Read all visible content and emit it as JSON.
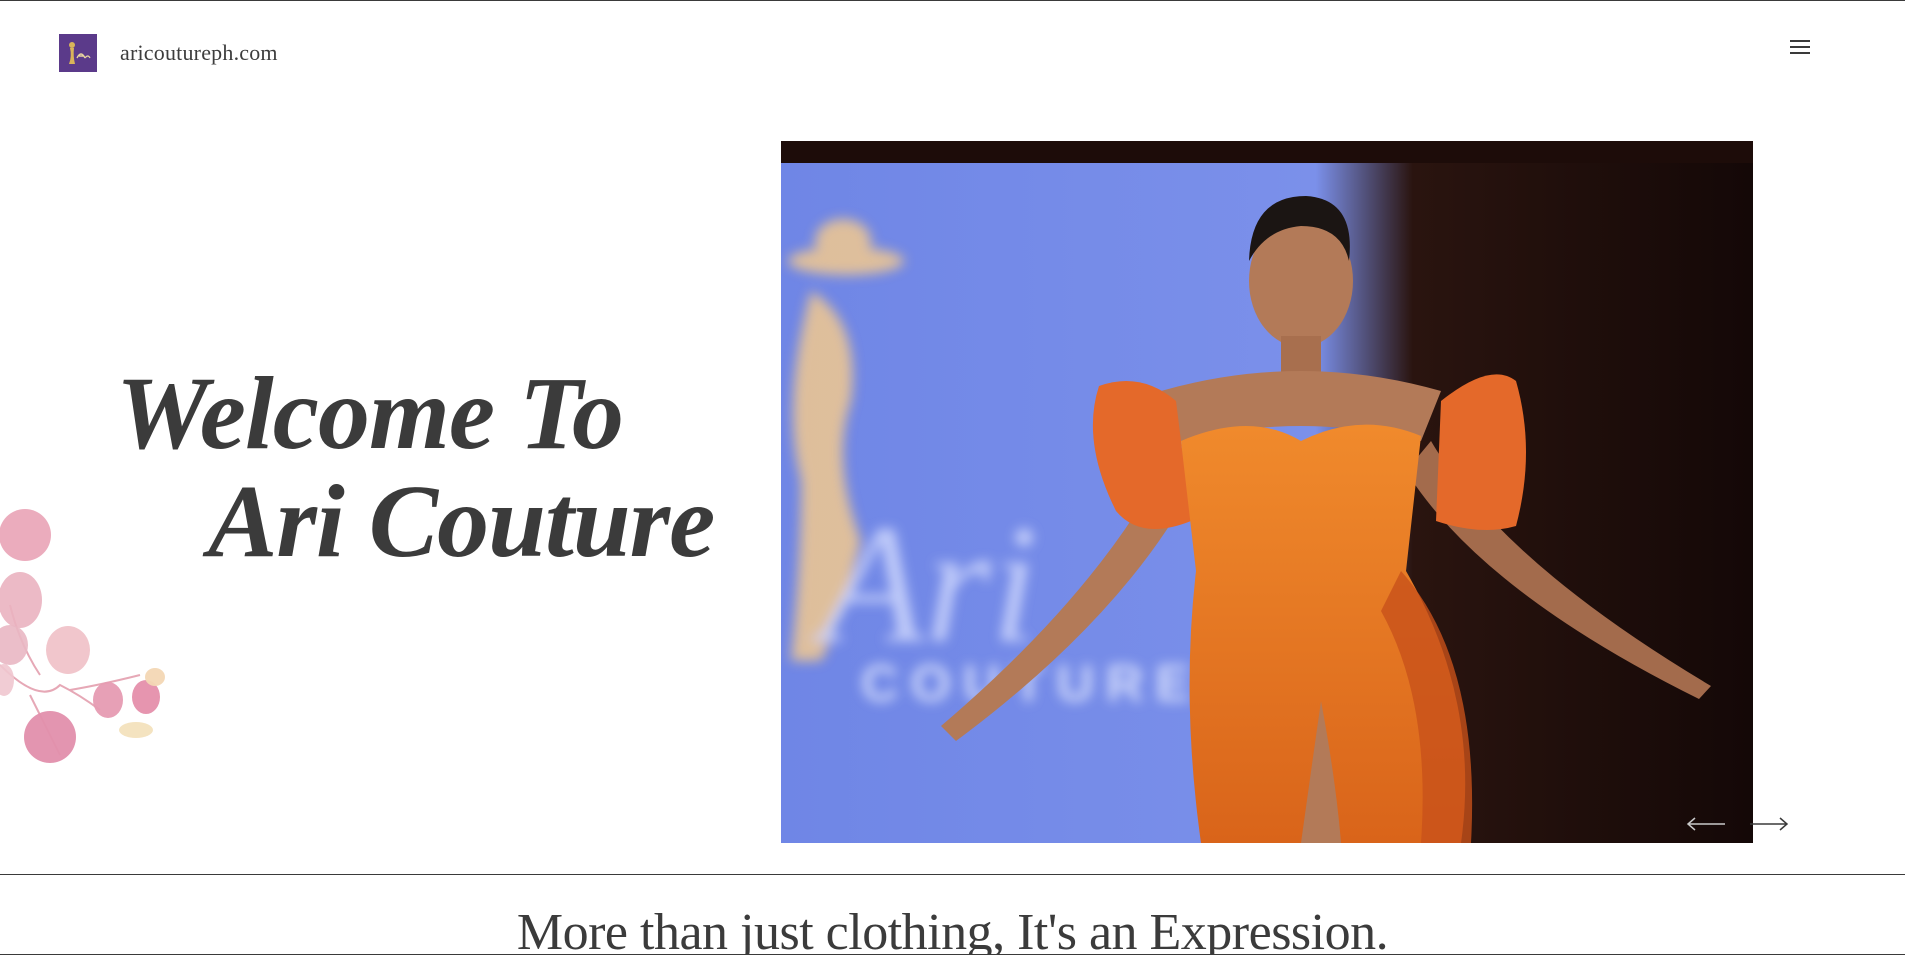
{
  "header": {
    "site_name": "aricoutureph.com",
    "logo_icon": "ari-couture-logo",
    "menu_icon": "hamburger-menu-icon"
  },
  "hero": {
    "title_line1": "Welcome To",
    "title_line2": "Ari Couture",
    "image_alt": "Model in orange satin off-shoulder gown on runway with Ari Couture backdrop",
    "prev_icon": "arrow-left-icon",
    "next_icon": "arrow-right-icon"
  },
  "section": {
    "tagline": "More than just clothing, It's an Expression."
  },
  "colors": {
    "text": "#3b3b3b",
    "logo_bg": "#5b3a8a",
    "backdrop_blue": "#6f86e6",
    "dress_orange": "#e9731f",
    "flower_pink": "#e8a3b8"
  }
}
